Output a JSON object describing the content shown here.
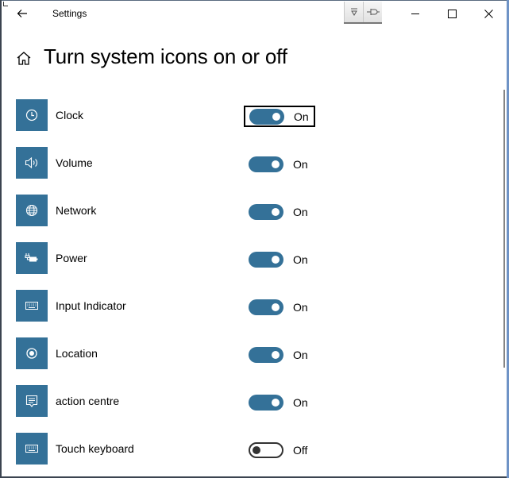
{
  "window": {
    "title": "Settings",
    "controls": {
      "minimize_icon": "minimize-icon",
      "maximize_icon": "maximize-icon",
      "close_icon": "close-icon"
    },
    "extensions": [
      "expand-down-icon",
      "pin-icon"
    ]
  },
  "header": {
    "back_icon": "back-arrow-icon",
    "home_icon": "home-icon",
    "title": "Turn system icons on or off"
  },
  "colors": {
    "accent": "#347198",
    "window_border": "#6f93c6"
  },
  "items": [
    {
      "label": "Clock",
      "icon": "clock-icon",
      "state": "On",
      "on": true,
      "focused": true
    },
    {
      "label": "Volume",
      "icon": "volume-icon",
      "state": "On",
      "on": true
    },
    {
      "label": "Network",
      "icon": "network-globe-icon",
      "state": "On",
      "on": true
    },
    {
      "label": "Power",
      "icon": "power-battery-icon",
      "state": "On",
      "on": true
    },
    {
      "label": "Input Indicator",
      "icon": "keyboard-icon",
      "state": "On",
      "on": true
    },
    {
      "label": "Location",
      "icon": "location-icon",
      "state": "On",
      "on": true
    },
    {
      "label": "action centre",
      "icon": "action-centre-icon",
      "state": "On",
      "on": true
    },
    {
      "label": "Touch keyboard",
      "icon": "touch-keyboard-icon",
      "state": "Off",
      "on": false
    }
  ]
}
